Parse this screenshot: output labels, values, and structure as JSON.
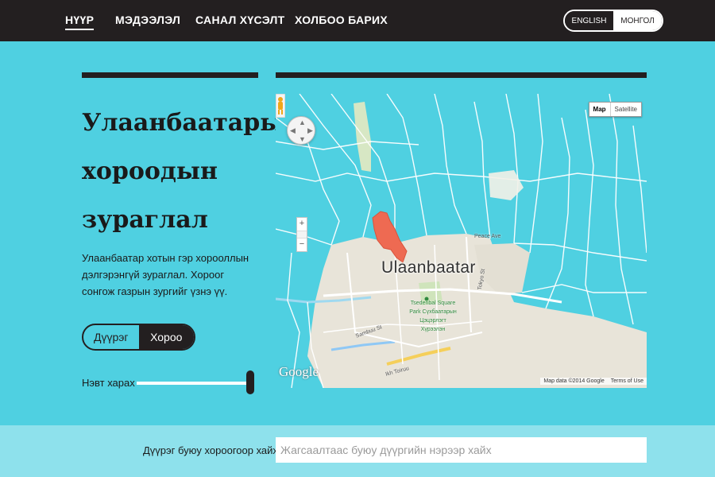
{
  "nav": {
    "items": [
      {
        "label": "НҮҮР"
      },
      {
        "label": "МЭДЭЭЛЭЛ"
      },
      {
        "label": "САНАЛ ХҮСЭЛТ"
      },
      {
        "label": "ХОЛБОО БАРИХ"
      }
    ],
    "active_index": 0
  },
  "language": {
    "english_label": "ENGLISH",
    "mongolian_label": "МОНГОЛ"
  },
  "hero": {
    "title": "Улаанбаатарын хороодын зураглал",
    "description": "Улаанбаатар хотын гэр хорооллын дэлгэрэнгүй зураглал. Хороог сонгож газрын зургийг үзнэ үү."
  },
  "view_toggle": {
    "district_label": "Дүүрэг",
    "khoroo_label": "Хороо",
    "selected": "Хороо"
  },
  "opacity": {
    "label": "Нэвт харах",
    "value": 1.0
  },
  "map": {
    "type_options": {
      "map": "Map",
      "satellite": "Satellite"
    },
    "selected_type": "Map",
    "city_label": "Ulaanbaatar",
    "logo": "Google",
    "attribution": "Map data ©2014 Google",
    "terms": "Terms of Use",
    "park_label": "Tsedenbal Square Park Сүхбаатарын Цэцэрлэгт Хүрээлэн",
    "street_labels": [
      "Peace Ave",
      "Tokyo St",
      "Sambuu St",
      "Ikh Toiruu"
    ],
    "colors": {
      "highlight": "#ee6a52",
      "boundary": "#ffffff",
      "urban": "#e8e4d9",
      "water": "#4fd0e1"
    }
  },
  "search": {
    "label": "Дүүрэг буюу хороогоор хайх:",
    "placeholder": "Жагсаалтаас буюу дүүргийн нэрээр хайх",
    "value": ""
  },
  "colors": {
    "background": "#4fd0e1",
    "dark": "#231f20",
    "search_band": "#8ee1ec"
  }
}
